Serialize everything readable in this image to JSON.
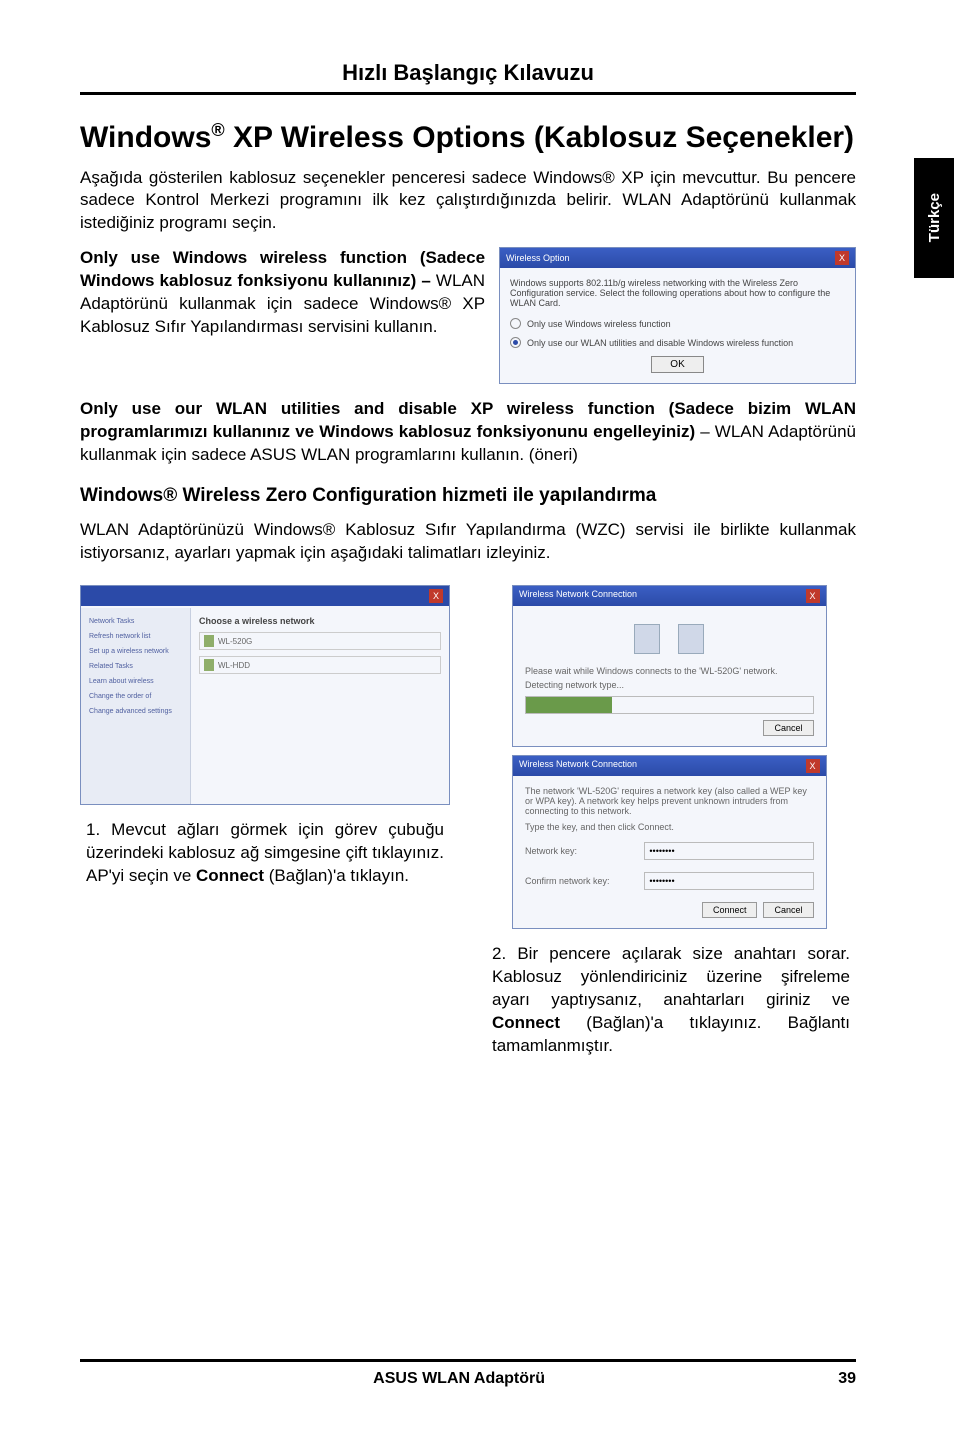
{
  "running_head": "Hızlı Başlangıç Kılavuzu",
  "sidebar_label": "Türkçe",
  "h1_a": "Windows",
  "h1_reg": "®",
  "h1_b": " XP Wireless Options (Kablosuz Seçenekler)",
  "lead": "Aşağıda gösterilen kablosuz seçenekler penceresi sadece Windows® XP için mevcuttur. Bu pencere sadece Kontrol Merkezi programını ilk kez çalıştırdığınızda belirir. WLAN Adaptörünü kullanmak istediğiniz programı seçin.",
  "opt1_strong": "Only use Windows wireless function (Sadece Windows kablosuz fonksiyonu kullanınız) – ",
  "opt1_rest": "WLAN Adaptörünü kullanmak için sadece Windows® XP Kablosuz Sıfır Yapılandırması servisini kullanın.",
  "dlg": {
    "title": "Wireless Option",
    "close": "X",
    "desc": "Windows supports 802.11b/g wireless networking with the Wireless Zero Configuration service. Select the following operations about how to configure the WLAN Card.",
    "r1": "Only use Windows wireless function",
    "r2": "Only use our WLAN utilities and disable Windows wireless function",
    "ok": "OK"
  },
  "opt2_strong": "Only use our WLAN utilities and disable XP wireless function (Sadece bizim WLAN programlarımızı kullanınız ve Windows kablosuz fonksiyonunu engelleyiniz)",
  "opt2_rest": " – WLAN Adaptörünü kullanmak için sadece ASUS WLAN programlarını kullanın. (öneri)",
  "h2": "Windows® Wireless Zero Configuration hizmeti ile yapılandırma",
  "h2_para": "WLAN Adaptörünüzü Windows® Kablosuz Sıfır Yapılandırma (WZC) servisi ile birlikte kullanmak istiyorsanız, ayarları yapmak için aşağıdaki talimatları izleyiniz.",
  "step1": {
    "banner": "Choose a wireless network",
    "side1": "Network Tasks",
    "side2": "Refresh network list",
    "side3": "Set up a wireless network",
    "side4": "Related Tasks",
    "side5": "Learn about wireless",
    "side6": "Change the order of",
    "side7": "Change advanced settings",
    "net1": "WL-520G",
    "net2": "WL-HDD",
    "caption": "1. Mevcut ağları görmek için görev çubuğu üzerindeki kablosuz ağ simgesine çift tıklayınız. AP'yi seçin ve ",
    "caption_b": "Connect",
    "caption_c": " (Bağlan)'a tıklayın."
  },
  "step2": {
    "title1": "Wireless Network Connection",
    "msg1": "Please wait while Windows connects to the 'WL-520G' network.",
    "msg1b": "Detecting network type...",
    "cancel1": "Cancel",
    "title2": "Wireless Network Connection",
    "msg2": "The network 'WL-520G' requires a network key (also called a WEP key or WPA key). A network key helps prevent unknown intruders from connecting to this network.",
    "lab1": "Type the key, and then click Connect.",
    "lab2": "Network key:",
    "lab3": "Confirm network key:",
    "btn_conn": "Connect",
    "btn_canc": "Cancel",
    "caption": "2. Bir pencere açılarak size anahtarı sorar. Kablosuz yönlendiriciniz üzerine şifreleme ayarı yaptıysanız, anahtarları giriniz ve ",
    "caption_b": "Connect",
    "caption_c": " (Bağlan)'a tıklayınız. Bağlantı tamamlanmıştır."
  },
  "footer_title": "ASUS WLAN Adaptörü",
  "footer_page": "39"
}
